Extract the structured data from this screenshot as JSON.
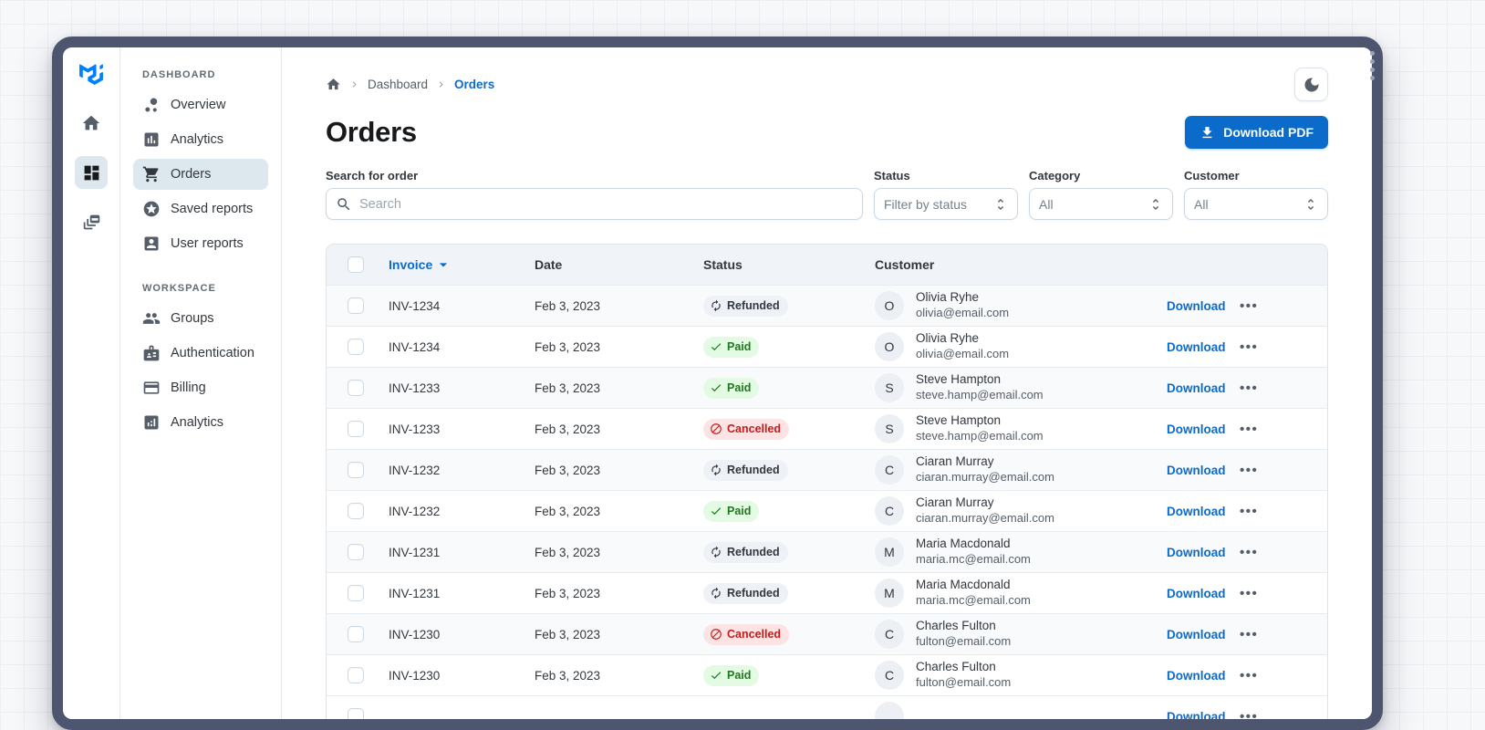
{
  "brand": {
    "logo_icon": "mui-logo",
    "logo_color": "#007FFF"
  },
  "rail": {
    "items": [
      {
        "icon": "home-icon",
        "selected": false
      },
      {
        "icon": "dashboard-grid-icon",
        "selected": true
      },
      {
        "icon": "dynamic-feed-icon",
        "selected": false
      }
    ]
  },
  "sidebar": {
    "sections": [
      {
        "label": "DASHBOARD",
        "items": [
          {
            "icon": "bubble-chart-icon",
            "label": "Overview",
            "selected": false
          },
          {
            "icon": "assessment-icon",
            "label": "Analytics",
            "selected": false
          },
          {
            "icon": "cart-icon",
            "label": "Orders",
            "selected": true
          },
          {
            "icon": "stars-icon",
            "label": "Saved reports",
            "selected": false
          },
          {
            "icon": "account-box-icon",
            "label": "User reports",
            "selected": false
          }
        ]
      },
      {
        "label": "WORKSPACE",
        "items": [
          {
            "icon": "group-icon",
            "label": "Groups",
            "selected": false
          },
          {
            "icon": "badge-icon",
            "label": "Authentication",
            "selected": false
          },
          {
            "icon": "credit-card-icon",
            "label": "Billing",
            "selected": false
          },
          {
            "icon": "analytics-icon",
            "label": "Analytics",
            "selected": false
          }
        ]
      }
    ]
  },
  "header": {
    "breadcrumbs": {
      "0": "Dashboard",
      "1": "Orders"
    },
    "title": "Orders",
    "download_button": "Download PDF",
    "theme_toggle_icon": "moon-icon"
  },
  "filters": {
    "search": {
      "label": "Search for order",
      "placeholder": "Search"
    },
    "status": {
      "label": "Status",
      "value": "Filter by status"
    },
    "category": {
      "label": "Category",
      "value": "All"
    },
    "customer": {
      "label": "Customer",
      "value": "All"
    }
  },
  "table": {
    "columns": {
      "invoice": "Invoice",
      "date": "Date",
      "status": "Status",
      "customer": "Customer"
    },
    "sorted_by": "Invoice",
    "row_action_label": "Download",
    "more_label": "•••",
    "rows": [
      {
        "invoice": "INV-1234",
        "date": "Feb 3, 2023",
        "status": "Refunded",
        "initial": "O",
        "name": "Olivia Ryhe",
        "email": "olivia@email.com"
      },
      {
        "invoice": "INV-1234",
        "date": "Feb 3, 2023",
        "status": "Paid",
        "initial": "O",
        "name": "Olivia Ryhe",
        "email": "olivia@email.com"
      },
      {
        "invoice": "INV-1233",
        "date": "Feb 3, 2023",
        "status": "Paid",
        "initial": "S",
        "name": "Steve Hampton",
        "email": "steve.hamp@email.com"
      },
      {
        "invoice": "INV-1233",
        "date": "Feb 3, 2023",
        "status": "Cancelled",
        "initial": "S",
        "name": "Steve Hampton",
        "email": "steve.hamp@email.com"
      },
      {
        "invoice": "INV-1232",
        "date": "Feb 3, 2023",
        "status": "Refunded",
        "initial": "C",
        "name": "Ciaran Murray",
        "email": "ciaran.murray@email.com"
      },
      {
        "invoice": "INV-1232",
        "date": "Feb 3, 2023",
        "status": "Paid",
        "initial": "C",
        "name": "Ciaran Murray",
        "email": "ciaran.murray@email.com"
      },
      {
        "invoice": "INV-1231",
        "date": "Feb 3, 2023",
        "status": "Refunded",
        "initial": "M",
        "name": "Maria Macdonald",
        "email": "maria.mc@email.com"
      },
      {
        "invoice": "INV-1231",
        "date": "Feb 3, 2023",
        "status": "Refunded",
        "initial": "M",
        "name": "Maria Macdonald",
        "email": "maria.mc@email.com"
      },
      {
        "invoice": "INV-1230",
        "date": "Feb 3, 2023",
        "status": "Cancelled",
        "initial": "C",
        "name": "Charles Fulton",
        "email": "fulton@email.com"
      },
      {
        "invoice": "INV-1230",
        "date": "Feb 3, 2023",
        "status": "Paid",
        "initial": "C",
        "name": "Charles Fulton",
        "email": "fulton@email.com"
      }
    ],
    "partial_row_visible": true
  },
  "colors": {
    "primary": "#0B6BCB",
    "frame": "#4D566E",
    "selected_bg": "#DDE7EE",
    "table_header_bg": "#F0F4F8",
    "chip_paid_bg": "#E3FBE3",
    "chip_paid_text": "#1F7A1F",
    "chip_refunded_bg": "#EEF1F6",
    "chip_refunded_text": "#32383E",
    "chip_cancelled_bg": "#FCE4E4",
    "chip_cancelled_text": "#C41C1C"
  }
}
